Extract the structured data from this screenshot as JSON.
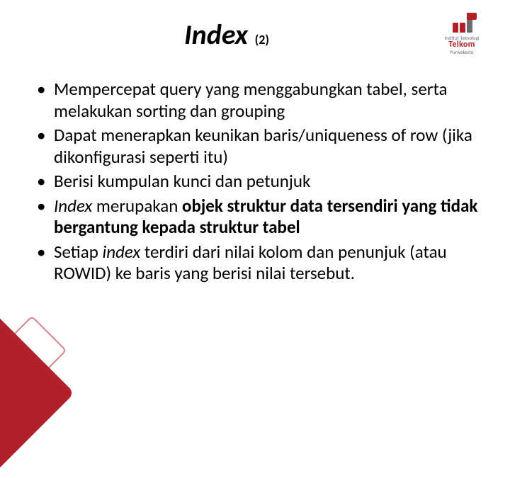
{
  "title": "Index",
  "title_suffix": "(2)",
  "logo": {
    "line1": "Institut Teknologi",
    "line2": "Telkom",
    "line3": "Purwokerto"
  },
  "bullets": [
    {
      "plain_pre": "Mempercepat query yang menggabungkan tabel, serta melakukan sorting dan grouping"
    },
    {
      "plain_pre": "Dapat menerapkan keunikan baris/uniqueness of row (jika dikonfigurasi seperti itu)"
    },
    {
      "plain_pre": "Berisi kumpulan kunci dan petunjuk"
    },
    {
      "italic1": "Index",
      "mid1": " merupakan ",
      "bold1": "objek struktur data tersendiri yang tidak bergantung kepada struktur tabel"
    },
    {
      "pre": "Setiap ",
      "italic1": "index",
      "post": " terdiri dari nilai kolom dan penunjuk (atau ROWID) ke baris yang berisi nilai tersebut."
    }
  ]
}
